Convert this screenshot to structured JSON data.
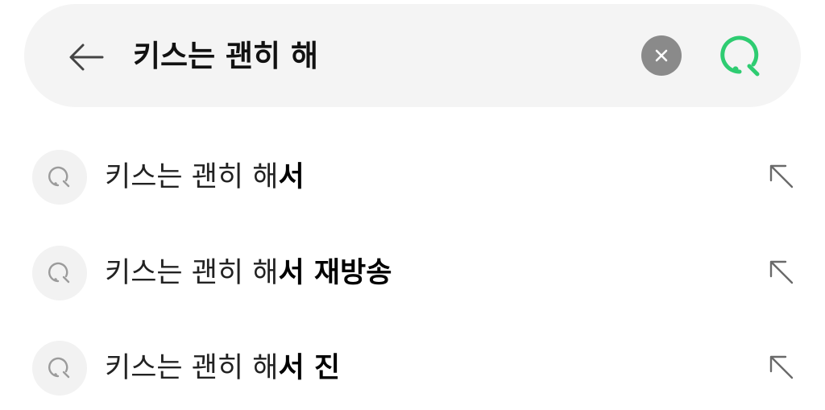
{
  "search": {
    "query": "키스는 괜히 해",
    "back_icon": "arrow-left-icon",
    "clear_icon": "clear-x-icon",
    "search_icon": "search-icon",
    "accent_color": "#2ecc71"
  },
  "suggestions": [
    {
      "prefix": "키스는 괜히 해",
      "completion": "서"
    },
    {
      "prefix": "키스는 괜히 해",
      "completion": "서 재방송"
    },
    {
      "prefix": "키스는 괜히 해",
      "completion": "서 진"
    }
  ]
}
